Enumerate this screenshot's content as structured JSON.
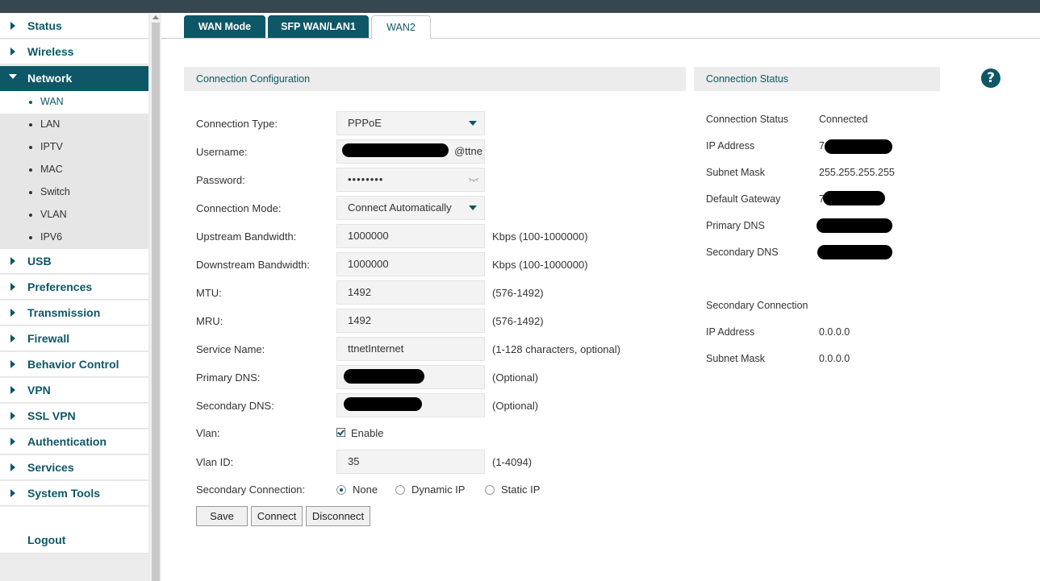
{
  "sidebar": {
    "items": [
      {
        "label": "Status"
      },
      {
        "label": "Wireless"
      },
      {
        "label": "Network"
      },
      {
        "label": "USB"
      },
      {
        "label": "Preferences"
      },
      {
        "label": "Transmission"
      },
      {
        "label": "Firewall"
      },
      {
        "label": "Behavior Control"
      },
      {
        "label": "VPN"
      },
      {
        "label": "SSL VPN"
      },
      {
        "label": "Authentication"
      },
      {
        "label": "Services"
      },
      {
        "label": "System Tools"
      }
    ],
    "network_sub": [
      {
        "label": "WAN"
      },
      {
        "label": "LAN"
      },
      {
        "label": "IPTV"
      },
      {
        "label": "MAC"
      },
      {
        "label": "Switch"
      },
      {
        "label": "VLAN"
      },
      {
        "label": "IPV6"
      }
    ],
    "logout": "Logout"
  },
  "tabs": [
    {
      "label": "WAN Mode"
    },
    {
      "label": "SFP WAN/LAN1"
    },
    {
      "label": "WAN2"
    }
  ],
  "config": {
    "title": "Connection Configuration",
    "connection_type": {
      "label": "Connection Type:",
      "value": "PPPoE"
    },
    "username": {
      "label": "Username:",
      "value_suffix": "@ttne"
    },
    "password": {
      "label": "Password:",
      "value": "••••••••"
    },
    "connection_mode": {
      "label": "Connection Mode:",
      "value": "Connect Automatically"
    },
    "upstream": {
      "label": "Upstream Bandwidth:",
      "value": "1000000",
      "hint": "Kbps (100-1000000)"
    },
    "downstream": {
      "label": "Downstream Bandwidth:",
      "value": "1000000",
      "hint": "Kbps (100-1000000)"
    },
    "mtu": {
      "label": "MTU:",
      "value": "1492",
      "hint": "(576-1492)"
    },
    "mru": {
      "label": "MRU:",
      "value": "1492",
      "hint": "(576-1492)"
    },
    "service_name": {
      "label": "Service Name:",
      "value": "ttnetInternet",
      "hint": "(1-128 characters, optional)"
    },
    "primary_dns": {
      "label": "Primary DNS:",
      "hint": "(Optional)"
    },
    "secondary_dns": {
      "label": "Secondary DNS:",
      "hint": "(Optional)"
    },
    "vlan": {
      "label": "Vlan:",
      "checkbox_label": "Enable",
      "checked": true
    },
    "vlan_id": {
      "label": "Vlan ID:",
      "value": "35",
      "hint": "(1-4094)"
    },
    "secondary_connection": {
      "label": "Secondary Connection:",
      "options": [
        "None",
        "Dynamic IP",
        "Static IP"
      ],
      "selected": "None"
    },
    "buttons": {
      "save": "Save",
      "connect": "Connect",
      "disconnect": "Disconnect"
    }
  },
  "status": {
    "title": "Connection Status",
    "rows": [
      {
        "label": "Connection Status",
        "value": "Connected"
      },
      {
        "label": "IP Address",
        "value": "7"
      },
      {
        "label": "Subnet Mask",
        "value": "255.255.255.255"
      },
      {
        "label": "Default Gateway",
        "value": "7"
      },
      {
        "label": "Primary DNS",
        "value": ""
      },
      {
        "label": "Secondary DNS",
        "value": ""
      }
    ],
    "secondary_title": "Secondary Connection",
    "secondary_rows": [
      {
        "label": "IP Address",
        "value": "0.0.0.0"
      },
      {
        "label": "Subnet Mask",
        "value": "0.0.0.0"
      }
    ]
  },
  "help_icon": "question-icon",
  "colors": {
    "accent": "#0d5767",
    "topbar": "#37474f",
    "panel_head": "#ececec",
    "field_bg": "#f3f3f3"
  }
}
